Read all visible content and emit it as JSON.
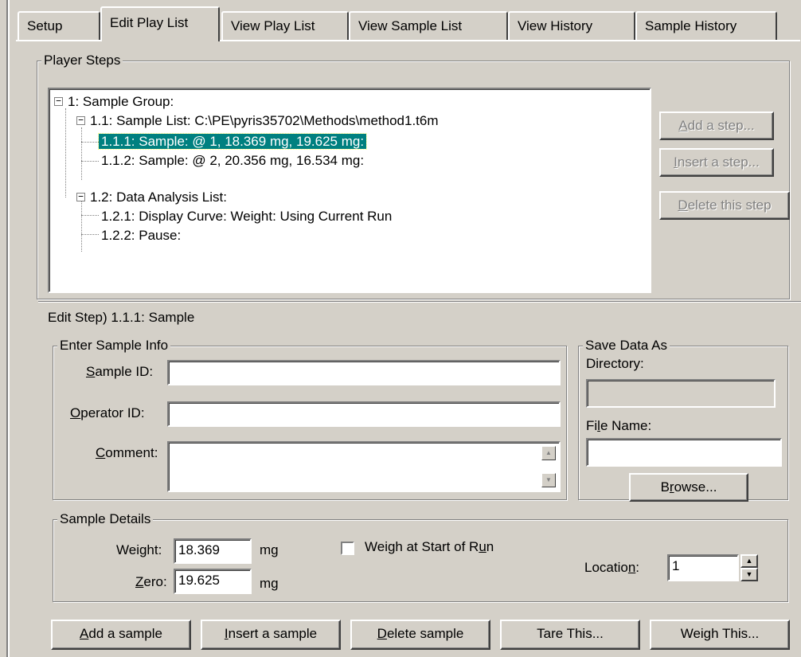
{
  "tabs": [
    {
      "label": "Setup"
    },
    {
      "label": "Edit Play List"
    },
    {
      "label": "View Play List"
    },
    {
      "label": "View Sample List"
    },
    {
      "label": "View History"
    },
    {
      "label": "Sample History"
    }
  ],
  "player_steps": {
    "title": "Player Steps",
    "tree": [
      {
        "label": "1: Sample Group:"
      },
      {
        "label": "1.1: Sample List: C:\\PE\\pyris35702\\Methods\\method1.t6m"
      },
      {
        "label": "1.1.1: Sample:  @ 1, 18.369 mg, 19.625 mg:"
      },
      {
        "label": "1.1.2: Sample:  @ 2, 20.356 mg, 16.534 mg:"
      },
      {
        "label": "1.2: Data Analysis List:"
      },
      {
        "label": "1.2.1: Display Curve: Weight: Using Current Run"
      },
      {
        "label": "1.2.2: Pause:"
      }
    ],
    "buttons": {
      "add_step": {
        "mn": "A",
        "rest": "dd a step..."
      },
      "insert_step": {
        "mn": "I",
        "rest": "nsert a step..."
      },
      "delete_step": {
        "mn": "D",
        "rest": "elete this step"
      }
    }
  },
  "edit_step": {
    "title": "Edit Step)  1.1.1: Sample"
  },
  "sample_info": {
    "title": "Enter Sample Info",
    "sample_id": {
      "mn": "S",
      "rest": "ample ID:",
      "value": ""
    },
    "operator_id": {
      "mn": "O",
      "rest": "perator ID:",
      "value": ""
    },
    "comment": {
      "mn": "C",
      "rest": "omment:",
      "value": ""
    }
  },
  "save_data": {
    "title": "Save Data As",
    "directory_label": "Directory:",
    "directory_value": "",
    "file_name": {
      "pre": "Fi",
      "mn": "l",
      "rest": "e Name:",
      "value": ""
    },
    "browse": {
      "pre": "B",
      "mn": "r",
      "rest": "owse..."
    }
  },
  "sample_details": {
    "title": "Sample Details",
    "weight_label": "Weight:",
    "weight_value": "18.369",
    "weight_unit": "mg",
    "zero": {
      "mn": "Z",
      "rest": "ero:"
    },
    "zero_value": "19.625",
    "zero_unit": "mg",
    "weigh_start": {
      "pre": "Weigh at Start of R",
      "mn": "u",
      "rest": "n",
      "checked": false
    },
    "location": {
      "pre": "Locatio",
      "mn": "n",
      "rest": ":"
    },
    "location_value": "1"
  },
  "bottom_buttons": {
    "add_sample": {
      "mn": "A",
      "rest": "dd a sample"
    },
    "insert_sample": {
      "mn": "I",
      "rest": "nsert a sample"
    },
    "delete_sample": {
      "mn": "D",
      "rest": "elete sample"
    },
    "tare": "Tare This...",
    "weigh": "Weigh This..."
  }
}
